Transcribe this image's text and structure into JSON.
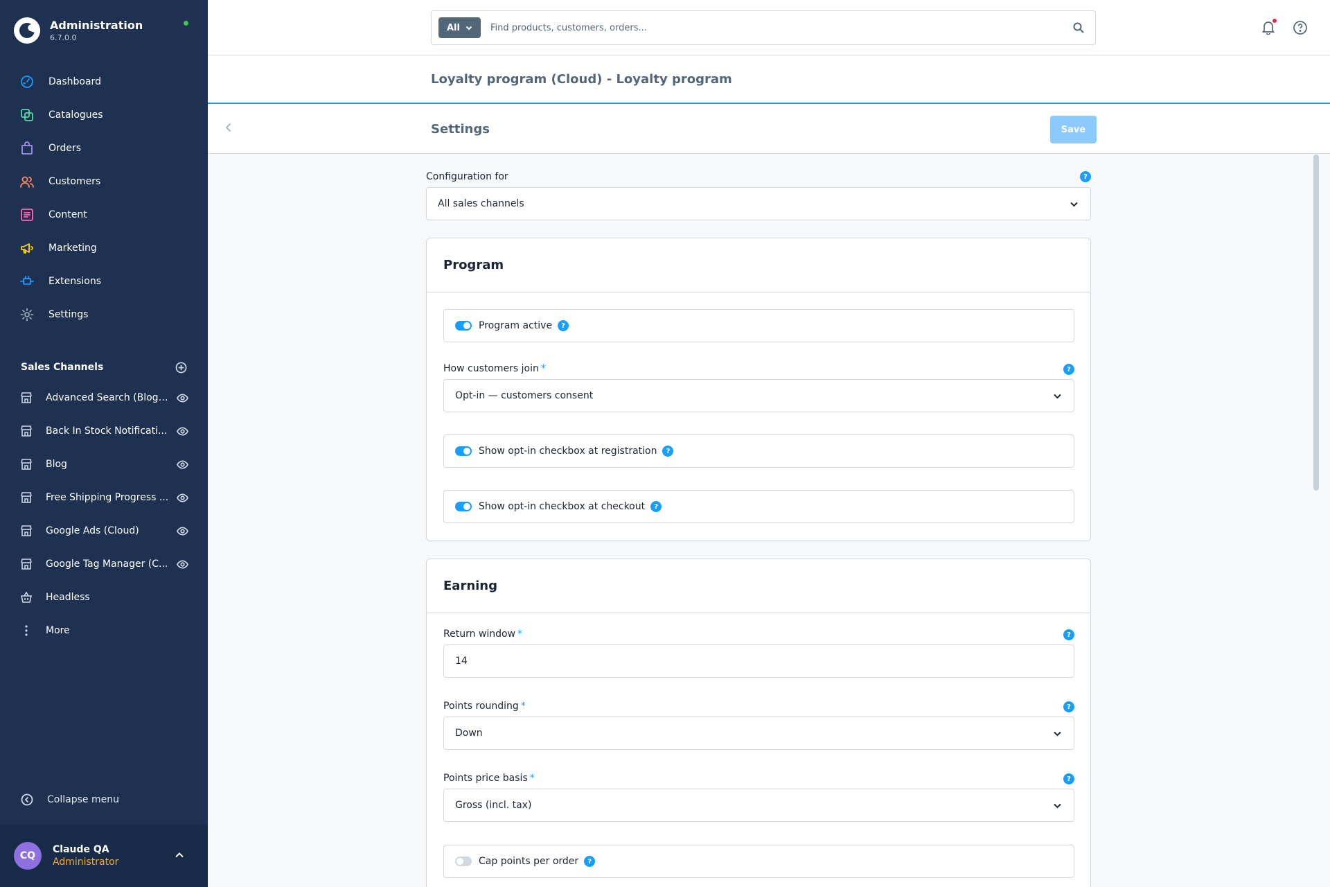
{
  "brand": {
    "title": "Administration",
    "version": "6.7.0.0"
  },
  "nav": [
    {
      "label": "Dashboard",
      "icon": "dashboard-icon",
      "color": "#189eff"
    },
    {
      "label": "Catalogues",
      "icon": "catalogue-icon",
      "color": "#57d9a3"
    },
    {
      "label": "Orders",
      "icon": "orders-icon",
      "color": "#a092f0"
    },
    {
      "label": "Customers",
      "icon": "customers-icon",
      "color": "#f88962"
    },
    {
      "label": "Content",
      "icon": "content-icon",
      "color": "#ff68b4"
    },
    {
      "label": "Marketing",
      "icon": "marketing-icon",
      "color": "#ffd700"
    },
    {
      "label": "Extensions",
      "icon": "extensions-icon",
      "color": "#189eff"
    },
    {
      "label": "Settings",
      "icon": "settings-icon",
      "color": "#9aa8b5"
    }
  ],
  "sales_channels": {
    "title": "Sales Channels",
    "items": [
      {
        "label": "Advanced Search (Blog ...",
        "icon": "storefront-icon",
        "eye": true
      },
      {
        "label": "Back In Stock Notificati...",
        "icon": "storefront-icon",
        "eye": true
      },
      {
        "label": "Blog",
        "icon": "storefront-icon",
        "eye": true
      },
      {
        "label": "Free Shipping Progress ...",
        "icon": "storefront-icon",
        "eye": true
      },
      {
        "label": "Google Ads (Cloud)",
        "icon": "storefront-icon",
        "eye": true
      },
      {
        "label": "Google Tag Manager (C...",
        "icon": "storefront-icon",
        "eye": true
      },
      {
        "label": "Headless",
        "icon": "basket-icon",
        "eye": false
      },
      {
        "label": "More",
        "icon": "more-icon",
        "eye": false
      }
    ]
  },
  "collapse_label": "Collapse menu",
  "user": {
    "initials": "CQ",
    "name": "Claude QA",
    "role": "Administrator"
  },
  "search": {
    "type": "All",
    "placeholder": "Find products, customers, orders..."
  },
  "page": {
    "title": "Loyalty program (Cloud) - Loyalty program"
  },
  "smart_bar": {
    "title": "Settings",
    "save_label": "Save"
  },
  "config": {
    "label": "Configuration for",
    "value": "All sales channels"
  },
  "program": {
    "title": "Program",
    "active_label": "Program active",
    "join_label": "How customers join",
    "join_value": "Opt-in — customers consent",
    "registration_label": "Show opt-in checkbox at registration",
    "checkout_label": "Show opt-in checkbox at checkout"
  },
  "earning": {
    "title": "Earning",
    "return_window_label": "Return window",
    "return_window_value": "14",
    "rounding_label": "Points rounding",
    "rounding_value": "Down",
    "price_basis_label": "Points price basis",
    "price_basis_value": "Gross (incl. tax)",
    "cap_label": "Cap points per order"
  },
  "help_glyph": "?",
  "required_mark": "*"
}
